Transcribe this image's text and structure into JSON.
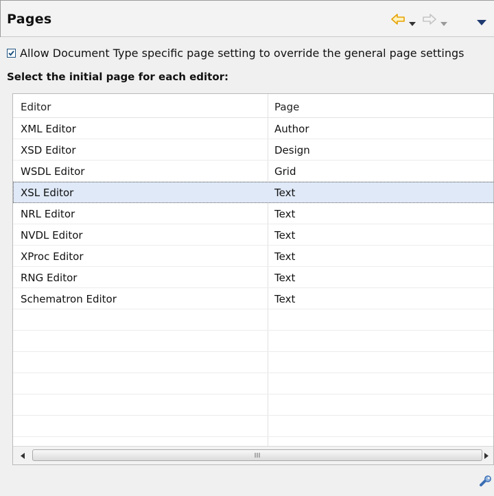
{
  "header": {
    "title": "Pages",
    "icons": [
      "back-arrow-icon",
      "back-dropdown-icon",
      "forward-arrow-icon",
      "forward-dropdown-icon",
      "view-menu-icon"
    ]
  },
  "override": {
    "checked": true,
    "label": "Allow Document Type specific page setting to override the general page settings"
  },
  "section_label": "Select the initial page for each editor:",
  "table": {
    "columns": [
      "Editor",
      "Page"
    ],
    "rows": [
      {
        "editor": "XML Editor",
        "page": "Author"
      },
      {
        "editor": "XSD Editor",
        "page": "Design"
      },
      {
        "editor": "WSDL Editor",
        "page": "Grid"
      },
      {
        "editor": "XSL Editor",
        "page": "Text"
      },
      {
        "editor": "NRL Editor",
        "page": "Text"
      },
      {
        "editor": "NVDL Editor",
        "page": "Text"
      },
      {
        "editor": "XProc Editor",
        "page": "Text"
      },
      {
        "editor": "RNG Editor",
        "page": "Text"
      },
      {
        "editor": "Schematron Editor",
        "page": "Text"
      }
    ],
    "selected_row": 3
  },
  "colors": {
    "accent_arrow": "#e6a100",
    "selection": "#dfe9f7",
    "check_blue": "#1c5180"
  },
  "footer": {
    "icon": "wrench-icon"
  }
}
